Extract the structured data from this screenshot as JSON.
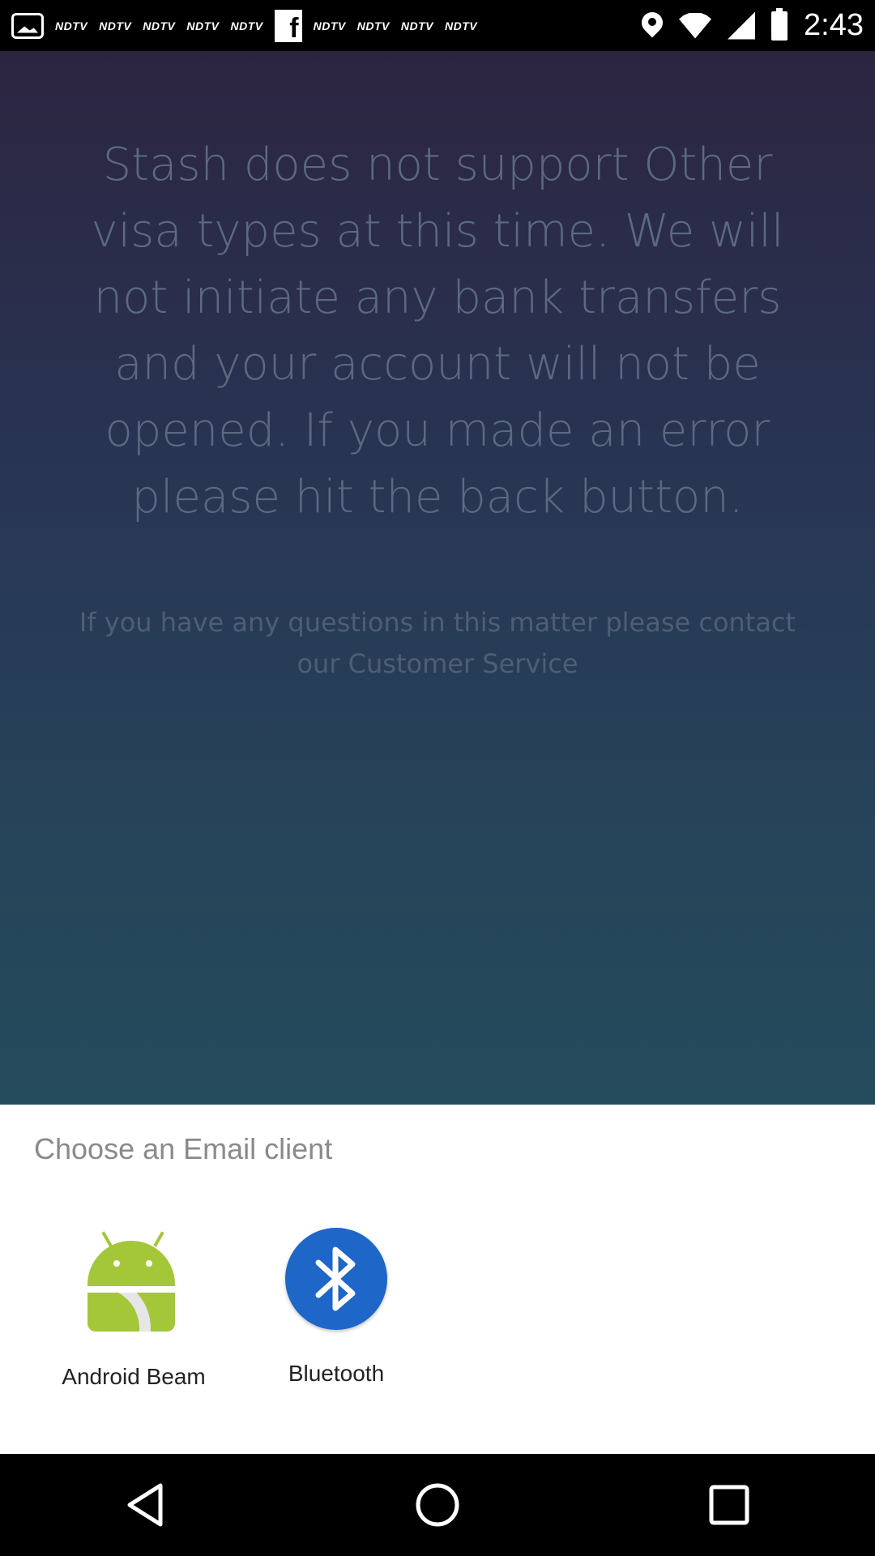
{
  "status_bar": {
    "time": "2:43",
    "notification_icons": [
      "gallery-icon",
      "ndtv-icon",
      "ndtv-icon",
      "ndtv-icon",
      "ndtv-icon",
      "ndtv-icon",
      "facebook-icon",
      "ndtv-icon",
      "ndtv-icon",
      "ndtv-icon",
      "ndtv-icon"
    ],
    "ndtv_text": "NDTV",
    "facebook_text": "f",
    "system_icons": [
      "location-icon",
      "wifi-icon",
      "signal-icon",
      "battery-icon"
    ]
  },
  "background_app": {
    "main_message": "Stash does not support Other visa types at this time. We will not initiate any bank transfers and your account will not be opened. If you made an error please hit the back button.",
    "contact_message": "If you have any questions in this matter please contact our Customer Service"
  },
  "chooser": {
    "title": "Choose an Email client",
    "options": [
      {
        "label": "Android Beam",
        "icon": "android-beam-icon"
      },
      {
        "label": "Bluetooth",
        "icon": "bluetooth-icon"
      }
    ]
  },
  "nav_bar": {
    "buttons": [
      "back-icon",
      "home-icon",
      "recents-icon"
    ]
  },
  "colors": {
    "bluetooth_blue": "#1e66c7",
    "android_green": "#a4c639",
    "sheet_background": "#ffffff"
  }
}
